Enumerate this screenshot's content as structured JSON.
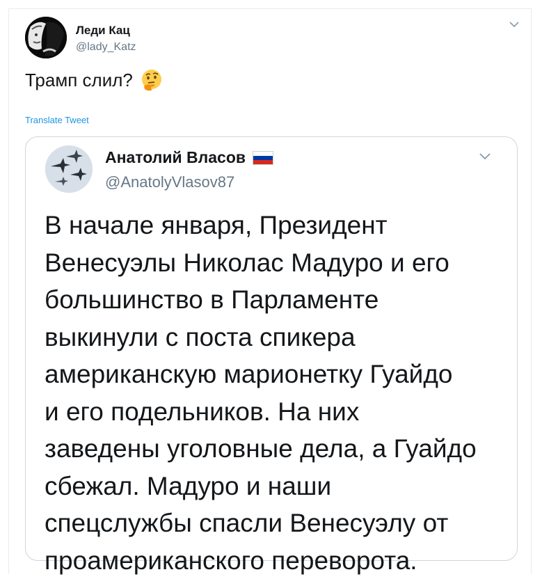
{
  "tweet": {
    "author_name": "Леди Кац",
    "author_handle": "@lady_Katz",
    "text": "Трамп слил?",
    "emoji_icon": "thinking-face-icon",
    "translate_label": "Translate Tweet"
  },
  "quoted_tweet": {
    "author_name": "Анатолий Власов",
    "flag_icon": "russia-flag-icon",
    "author_handle": "@AnatolyVlasov87",
    "lines": [
      "В начале января, Президент",
      "Венесуэлы Николас Мадуро и его",
      "большинство в Парламенте",
      "выкинули с поста спикера",
      "американскую марионетку Гуайдо",
      "и его подельников. На них",
      "заведены уголовные дела, а Гуайдо",
      "сбежал. Мадуро и наши",
      "спецслужбы спасли Венесуэлу от",
      "проамериканского переворота."
    ]
  },
  "colors": {
    "text_primary": "#14171a",
    "text_secondary": "#657786",
    "link": "#1b95e0",
    "border": "#ccd6dd"
  }
}
